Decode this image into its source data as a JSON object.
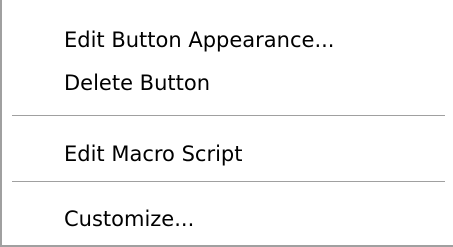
{
  "context_menu": {
    "items": [
      {
        "label": "Edit Button Appearance..."
      },
      {
        "label": "Delete Button"
      },
      {
        "label": "Edit Macro Script"
      },
      {
        "label": "Customize..."
      }
    ]
  }
}
